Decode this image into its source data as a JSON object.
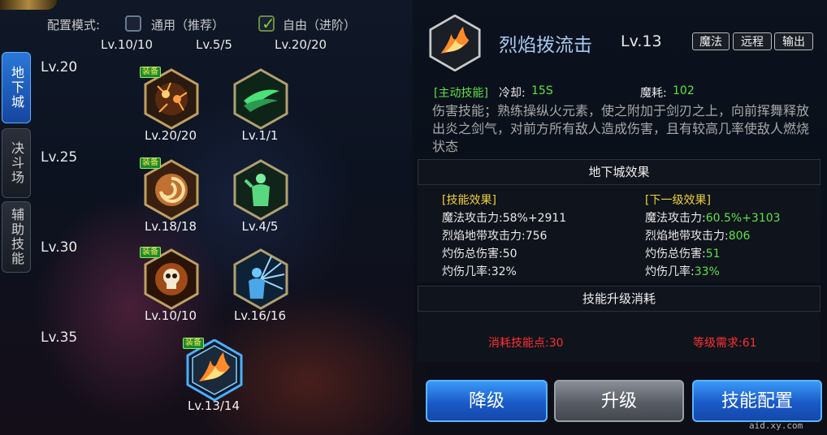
{
  "config": {
    "label": "配置模式:",
    "mode_general": "通用（推荐）",
    "mode_free": "自由（进阶）",
    "mode_free_checked": true
  },
  "columns": [
    "Lv.10/10",
    "Lv.5/5",
    "Lv.20/20"
  ],
  "rows": [
    "Lv.20",
    "Lv.25",
    "Lv.30",
    "Lv.35"
  ],
  "tabs": [
    "地下城",
    "决斗场",
    "辅助技能"
  ],
  "skills": [
    {
      "level": "Lv.20/20",
      "equipped": true,
      "icon": "firework-burst-icon"
    },
    {
      "level": "Lv.1/1",
      "equipped": false,
      "icon": "green-slash-icon"
    },
    {
      "level": "Lv.18/18",
      "equipped": true,
      "icon": "fire-swirl-icon"
    },
    {
      "level": "Lv.4/5",
      "equipped": false,
      "icon": "green-figure-buff-icon"
    },
    {
      "level": "Lv.10/10",
      "equipped": true,
      "icon": "flame-skull-icon"
    },
    {
      "level": "Lv.16/16",
      "equipped": false,
      "icon": "blue-radiant-figure-icon"
    },
    {
      "level": "Lv.13/14",
      "equipped": true,
      "icon": "flame-burst-icon"
    }
  ],
  "equip_badge": "装备",
  "detail": {
    "name": "烈焰拨流击",
    "level": "Lv.13",
    "tags": [
      "魔法",
      "远程",
      "输出"
    ],
    "type": "[主动技能]",
    "cooldown_label": "冷却:",
    "cooldown": "15S",
    "mp_label": "魔耗:",
    "mp": "102",
    "description": "伤害技能；熟练操纵火元素，使之附加于剑刃之上，向前挥舞释放出炎之剑气，对前方所有敌人造成伤害，且有较高几率使敌人燃烧状态"
  },
  "dungeon_section": "地下城效果",
  "effects": {
    "current_title": "[技能效果]",
    "next_title": "[下一级效果]",
    "current": [
      {
        "label": "魔法攻击力:",
        "value": "58%+2911"
      },
      {
        "label": "烈焰地带攻击力:",
        "value": "756"
      },
      {
        "label": "灼伤总伤害:",
        "value": "50"
      },
      {
        "label": "灼伤几率:",
        "value": "32%"
      }
    ],
    "next": [
      {
        "label": "魔法攻击力:",
        "value": "60.5%+3103"
      },
      {
        "label": "烈焰地带攻击力:",
        "value": "806"
      },
      {
        "label": "灼伤总伤害:",
        "value": "51"
      },
      {
        "label": "灼伤几率:",
        "value": "33%"
      }
    ]
  },
  "upgrade_section": "技能升级消耗",
  "cost": {
    "sp": "消耗技能点:30",
    "req": "等级需求:61"
  },
  "buttons": {
    "down": "降级",
    "up": "升级",
    "config": "技能配置"
  },
  "watermark": "aid.xy.com",
  "colors": {
    "accent_blue": "#2a78d8",
    "green": "#5ee04a",
    "red": "#ff3030",
    "yellow": "#f0d03a"
  }
}
